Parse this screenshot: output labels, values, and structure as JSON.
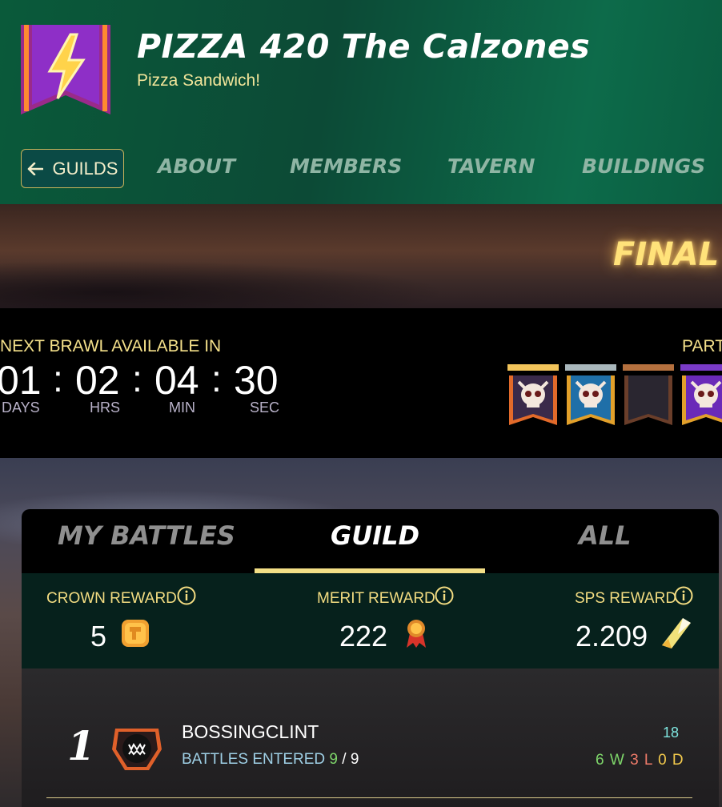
{
  "guild": {
    "name": "PIZZA 420 The Calzones",
    "motto": "Pizza Sandwich!",
    "banner_icon": "lightning-icon"
  },
  "nav": {
    "back_label": "GUILDS",
    "tabs": [
      "ABOUT",
      "MEMBERS",
      "TAVERN",
      "BUILDINGS"
    ]
  },
  "hero": {
    "title": "FINAL B"
  },
  "brawl": {
    "label": "NEXT BRAWL AVAILABLE IN",
    "timer": [
      {
        "value": "01",
        "unit": "DAYS"
      },
      {
        "value": "02",
        "unit": "HRS"
      },
      {
        "value": "04",
        "unit": "MIN"
      },
      {
        "value": "30",
        "unit": "SEC"
      }
    ],
    "separator": ":",
    "participants_label": "PART",
    "slots": [
      {
        "bar_color": "#f2c45a",
        "frame": "gold",
        "icon": "skull-icon"
      },
      {
        "bar_color": "#a9b7bc",
        "frame": "blue",
        "icon": "skull-icon"
      },
      {
        "bar_color": "#b4703e",
        "frame": "bronze",
        "icon": ""
      },
      {
        "bar_color": "#7a3bc8",
        "frame": "purple",
        "icon": "skull-icon"
      }
    ]
  },
  "panel": {
    "tabs": [
      "MY BATTLES",
      "GUILD",
      "ALL"
    ],
    "active_tab": "GUILD",
    "rewards": [
      {
        "label": "CROWN REWARD",
        "value": "5",
        "icon": "crown-token-icon"
      },
      {
        "label": "MERIT REWARD",
        "value": "222",
        "icon": "merit-medal-icon"
      },
      {
        "label": "SPS REWARD",
        "value": "2.209",
        "icon": "sps-crystal-icon"
      }
    ]
  },
  "members": [
    {
      "rank": "1",
      "name": "BOSSINGCLINT",
      "battles_label": "BATTLES ENTERED",
      "battles_done": "9",
      "battles_slash": "/",
      "battles_total": "9",
      "score": "18",
      "wins": "6 W",
      "losses": "3 L",
      "draws": "0 D"
    }
  ],
  "colors": {
    "accent_gold": "#f3df86",
    "header_green": "#0c4a36",
    "win": "#7ed66a",
    "loss": "#ef7b6a",
    "draw": "#f2c94c"
  }
}
